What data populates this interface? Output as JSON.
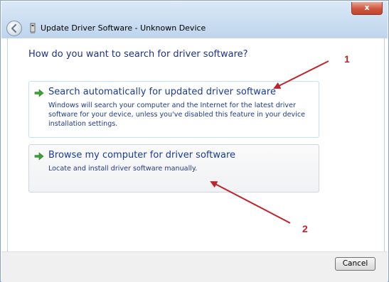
{
  "window": {
    "title": "Update Driver Software - Unknown Device",
    "close_glyph": "x"
  },
  "main": {
    "heading": "How do you want to search for driver software?",
    "options": [
      {
        "title": "Search automatically for updated driver software",
        "description": "Windows will search your computer and the Internet for the latest driver software for your device, unless you've disabled this feature in your device installation settings.",
        "icon": "green-arrow-icon"
      },
      {
        "title": "Browse my computer for driver software",
        "description": "Locate and install driver software manually.",
        "icon": "green-arrow-icon"
      }
    ]
  },
  "footer": {
    "cancel_label": "Cancel"
  },
  "annotations": {
    "label_1": "1",
    "label_2": "2",
    "color": "#c0222a"
  },
  "colors": {
    "heading": "#1e3287",
    "option_title": "#1a3b9a",
    "arrow_green": "#3aa335"
  }
}
